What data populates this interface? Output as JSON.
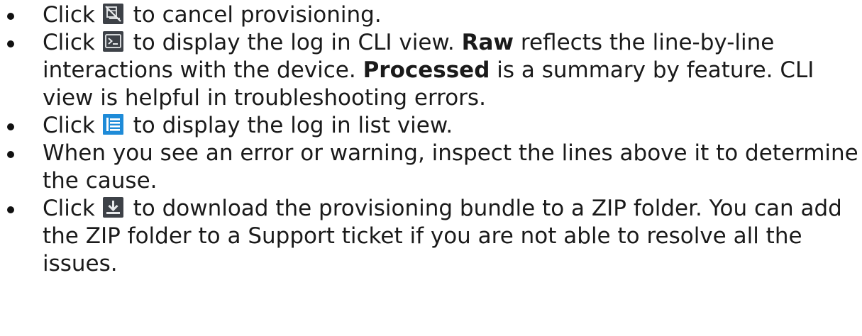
{
  "items": [
    {
      "click": "Click",
      "icon": "cancel-provisioning-icon",
      "text": "to cancel provisioning."
    },
    {
      "click": "Click",
      "icon": "cli-view-icon",
      "text1": "to display the log in CLI view.",
      "bold1": "Raw",
      "text2": "reflects the line-by-line interactions with the device.",
      "bold2": "Processed",
      "text3": "is a summary by feature. CLI view is helpful in troubleshooting errors."
    },
    {
      "click": "Click",
      "icon": "list-view-icon",
      "text": "to display the log in list view."
    },
    {
      "text": "When you see an error or warning, inspect the lines above it to determine the cause."
    },
    {
      "click": "Click",
      "icon": "download-icon",
      "text": "to download the provisioning bundle to a ZIP folder. You can add the ZIP folder to a Support ticket if you are not able to resolve all the issues."
    }
  ],
  "colors": {
    "text": "#1a1a1a",
    "icon_dark": "#3b3f45",
    "icon_blue": "#1e8bd8"
  }
}
